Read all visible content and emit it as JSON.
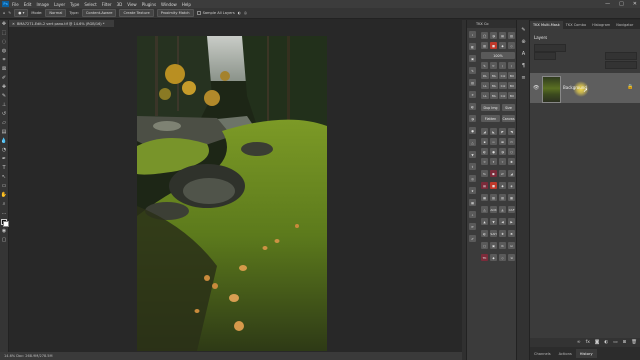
{
  "app": {
    "menu": [
      "File",
      "Edit",
      "Image",
      "Layer",
      "Type",
      "Select",
      "Filter",
      "3D",
      "View",
      "Plugins",
      "Window",
      "Help"
    ],
    "window_controls": [
      "—",
      "□",
      "✕"
    ]
  },
  "options_bar": {
    "mode_label": "Mode:",
    "mode_value": "Normal",
    "type_label": "Type:",
    "content_aware": "Content-Aware",
    "create_texture": "Create Texture",
    "proximity_match": "Proximity Match",
    "sample_all_layers": "Sample All Layers"
  },
  "document": {
    "tab_title": "BMA7271-Edit-2 vert pano.tif @ 14.6% (RGB/16) *",
    "status": "14.6%   Doc: 268.9M/278.5M"
  },
  "tk_panel": {
    "title": "TKX Co",
    "wide_buttons": [
      "Dup Img",
      "Size",
      "Flatten",
      "Canvas"
    ],
    "label_grid": [
      [
        "DL",
        "ML",
        "Col",
        "BU"
      ],
      [
        "LL",
        "ML",
        "Col",
        "BU"
      ],
      [
        "LL",
        "ML",
        "Col",
        "BU"
      ]
    ],
    "small_labels": [
      "ACR",
      "CAF",
      "SAH"
    ],
    "zoom_value": "100%"
  },
  "right_panel": {
    "tabs": [
      "TKX Multi-Mask",
      "TKX Combo",
      "Histogram",
      "Navigator"
    ],
    "active_tab": "Layers",
    "layers_title": "Layers",
    "layer_name": "Background",
    "bottom_tabs": [
      "Channels",
      "Actions",
      "History"
    ],
    "bottom_active": "History"
  },
  "colors": {
    "accent": "#31a8ff",
    "cursor_highlight": "#f2d84a",
    "tk_red": "#c0392b"
  }
}
